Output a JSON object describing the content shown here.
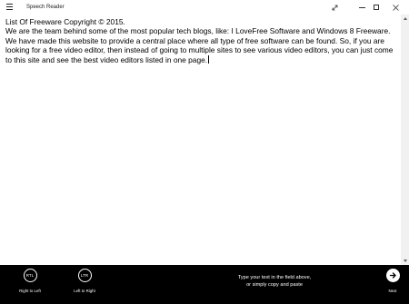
{
  "window": {
    "title": "Speech Reader",
    "menu_icon": "hamburger-menu-icon",
    "expand_icon": "expand-diagonal-icon",
    "minimize_icon": "minimize-icon",
    "maximize_icon": "maximize-icon",
    "close_icon": "close-icon"
  },
  "editor": {
    "text": "List Of Freeware Copyright © 2015.\nWe are the team behind some of the most popular tech blogs, like: I LoveFree Software and Windows 8 Freeware. We have made this website to provide a central place where all type of free software can be found. So, if you are looking for a free video editor, then instead of going to multiple sites to see various video editors, you can just come to this site and see the best video editors listed in one page."
  },
  "scrollbar": {
    "up_icon": "scroll-up-arrow-icon",
    "down_icon": "scroll-down-arrow-icon"
  },
  "appbar": {
    "rtl": {
      "badge": "RTL",
      "label": "Right to Left"
    },
    "ltr": {
      "badge": "LTR",
      "label": "Left to Right"
    },
    "hint_line1": "Type your text in the field above,",
    "hint_line2": "or simply copy and paste",
    "next": {
      "label": "Next",
      "icon": "arrow-right-icon"
    }
  },
  "colors": {
    "appbar_background": "#000000",
    "editor_background": "#ffffff",
    "text": "#000000"
  }
}
